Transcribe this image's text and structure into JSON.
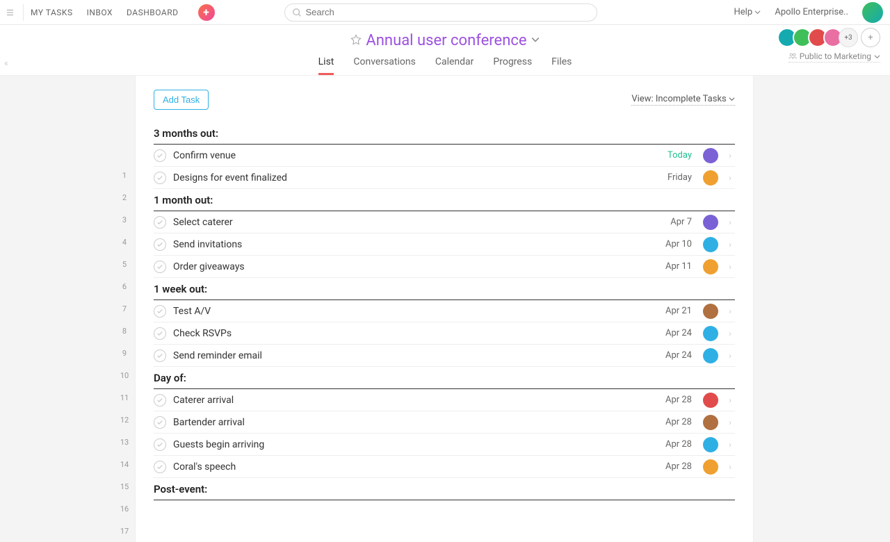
{
  "nav": {
    "my_tasks": "MY TASKS",
    "inbox": "INBOX",
    "dashboard": "DASHBOARD"
  },
  "search": {
    "placeholder": "Search"
  },
  "help": "Help",
  "workspace": "Apollo Enterprise..",
  "project": {
    "title": "Annual user conference"
  },
  "tabs": [
    "List",
    "Conversations",
    "Calendar",
    "Progress",
    "Files"
  ],
  "members_more": "+3",
  "privacy": "Public to Marketing",
  "toolbar": {
    "add_task": "Add Task",
    "view": "View: Incomplete Tasks"
  },
  "avatar_colors": {
    "teal": "#14aab0",
    "green": "#3fbf5a",
    "red": "#e24b4b",
    "pink": "#e96fa3",
    "purple": "#7b61d6",
    "orange": "#f0a030",
    "blue": "#2fb0e5",
    "brown": "#b07040"
  },
  "sections": [
    {
      "title": "3 months out:",
      "tasks": [
        {
          "name": "Confirm venue",
          "due": "Today",
          "today": true,
          "color": "purple"
        },
        {
          "name": "Designs for event finalized",
          "due": "Friday",
          "color": "orange"
        }
      ]
    },
    {
      "title": "1 month out:",
      "tasks": [
        {
          "name": "Select caterer",
          "due": "Apr 7",
          "color": "purple"
        },
        {
          "name": "Send invitations",
          "due": "Apr 10",
          "color": "blue"
        },
        {
          "name": "Order giveaways",
          "due": "Apr 11",
          "color": "orange"
        }
      ]
    },
    {
      "title": "1 week out:",
      "tasks": [
        {
          "name": "Test A/V",
          "due": "Apr 21",
          "color": "brown"
        },
        {
          "name": "Check RSVPs",
          "due": "Apr 24",
          "color": "blue"
        },
        {
          "name": "Send reminder email",
          "due": "Apr 24",
          "color": "blue"
        }
      ]
    },
    {
      "title": "Day of:",
      "tasks": [
        {
          "name": "Caterer arrival",
          "due": "Apr 28",
          "color": "red"
        },
        {
          "name": "Bartender arrival",
          "due": "Apr 28",
          "color": "brown"
        },
        {
          "name": "Guests begin arriving",
          "due": "Apr 28",
          "color": "blue"
        },
        {
          "name": "Coral's speech",
          "due": "Apr 28",
          "color": "orange"
        }
      ]
    },
    {
      "title": "Post-event:",
      "tasks": []
    }
  ]
}
